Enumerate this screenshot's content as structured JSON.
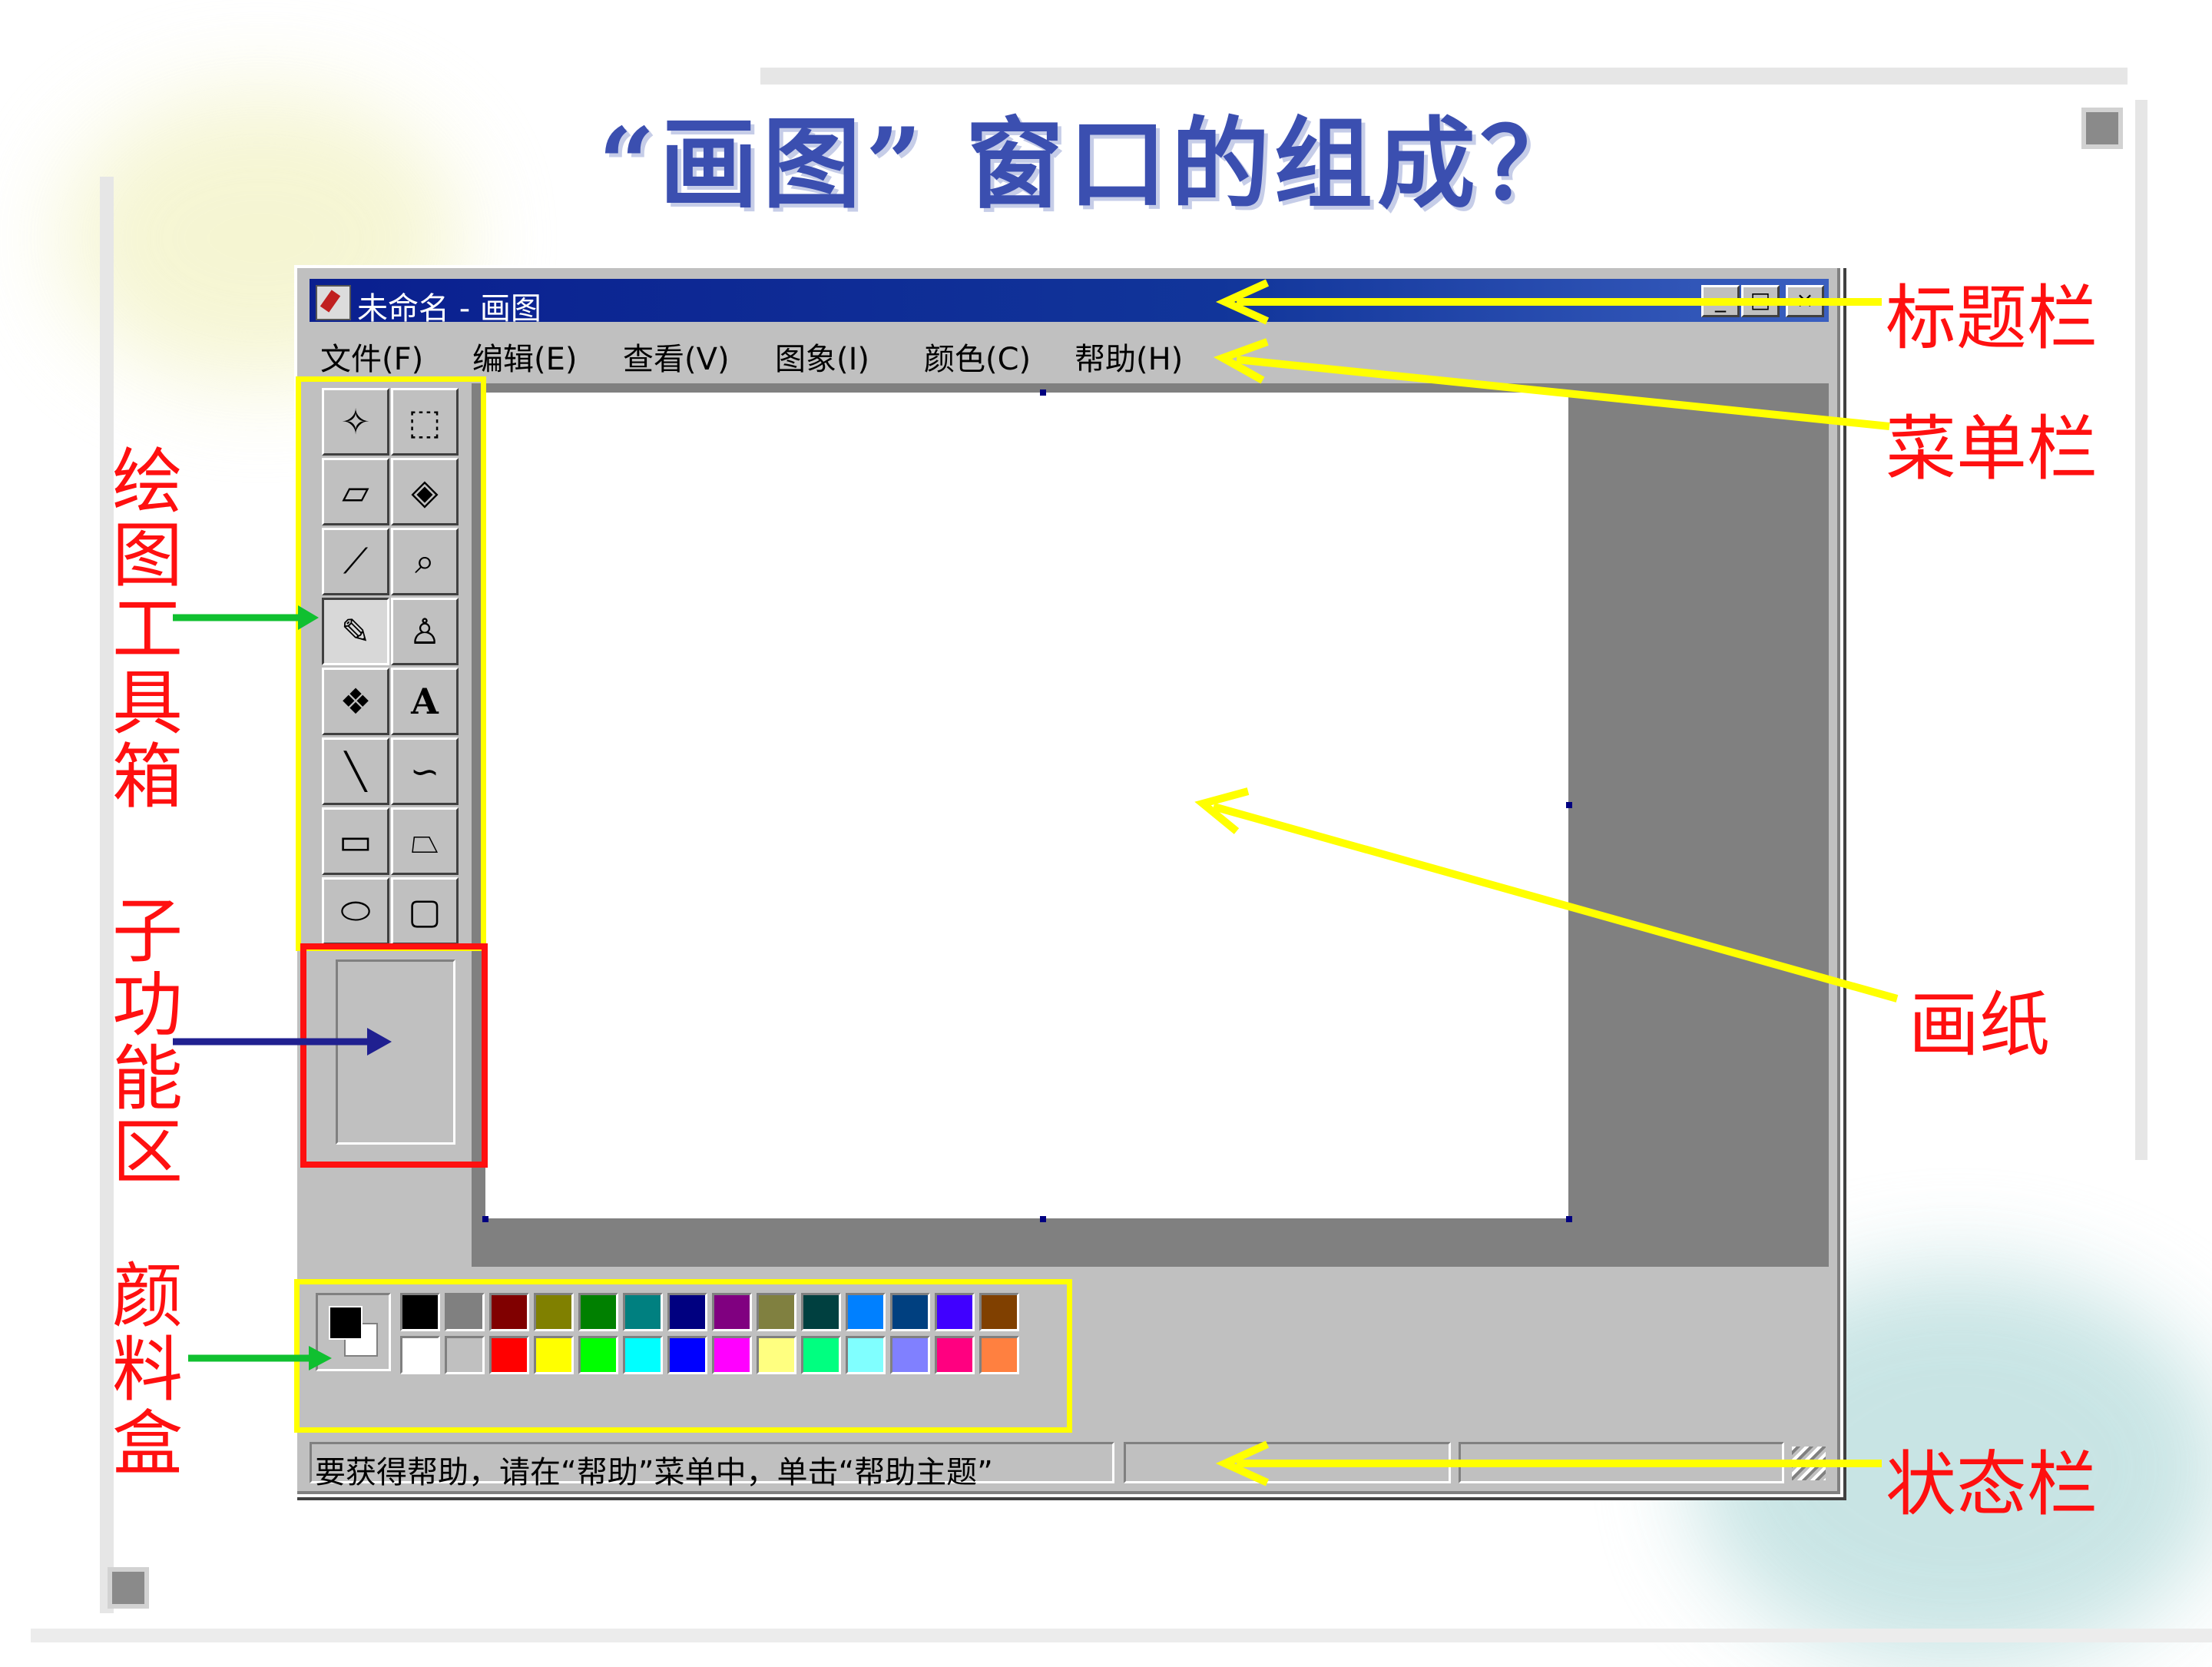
{
  "slide": {
    "title": "“画图” 窗口的组成？"
  },
  "window": {
    "title": "未命名 - 画图",
    "buttons": {
      "minimize": "_",
      "maximize": "□",
      "close": "×"
    },
    "menu": [
      "文件(F)",
      "编辑(E)",
      "查看(V)",
      "图象(I)",
      "颜色(C)",
      "帮助(H)"
    ],
    "tools": [
      {
        "name": "free-select-tool",
        "glyph": "✧"
      },
      {
        "name": "rect-select-tool",
        "glyph": "⬚"
      },
      {
        "name": "eraser-tool",
        "glyph": "▱"
      },
      {
        "name": "fill-tool",
        "glyph": "◈"
      },
      {
        "name": "color-picker-tool",
        "glyph": "⟋"
      },
      {
        "name": "magnifier-tool",
        "glyph": "⌕"
      },
      {
        "name": "pencil-tool",
        "glyph": "✎"
      },
      {
        "name": "brush-tool",
        "glyph": "♙"
      },
      {
        "name": "airbrush-tool",
        "glyph": "❖"
      },
      {
        "name": "text-tool",
        "glyph": "A"
      },
      {
        "name": "line-tool",
        "glyph": "╲"
      },
      {
        "name": "curve-tool",
        "glyph": "∽"
      },
      {
        "name": "rectangle-tool",
        "glyph": "▭"
      },
      {
        "name": "polygon-tool",
        "glyph": "⏢"
      },
      {
        "name": "ellipse-tool",
        "glyph": "⬭"
      },
      {
        "name": "rounded-rect-tool",
        "glyph": "▢"
      }
    ],
    "selected_tool": "pencil-tool",
    "palette": {
      "foreground": "#000000",
      "background": "#ffffff",
      "top_row": [
        "#000000",
        "#808080",
        "#800000",
        "#808000",
        "#008000",
        "#008080",
        "#000080",
        "#800080",
        "#808040",
        "#004040",
        "#0080ff",
        "#004080",
        "#4000ff",
        "#804000"
      ],
      "bottom_row": [
        "#ffffff",
        "#c0c0c0",
        "#ff0000",
        "#ffff00",
        "#00ff00",
        "#00ffff",
        "#0000ff",
        "#ff00ff",
        "#ffff80",
        "#00ff80",
        "#80ffff",
        "#8080ff",
        "#ff0080",
        "#ff8040"
      ]
    },
    "status_text": "要获得帮助，请在“帮助”菜单中，单击“帮助主题”"
  },
  "annotations": {
    "title_bar": "标题栏",
    "menu_bar": "菜单栏",
    "canvas": "画纸",
    "status_bar": "状态栏",
    "toolbox": "绘图工具箱",
    "options": "子功能区",
    "palette": "颜料盒"
  },
  "colors": {
    "annotation_text": "#ff1010",
    "highlight_yellow": "#ffff00",
    "highlight_red": "#ff1010",
    "arrow_green": "#10c030",
    "arrow_blue": "#202090",
    "title_blue": "#3b4fb0"
  }
}
